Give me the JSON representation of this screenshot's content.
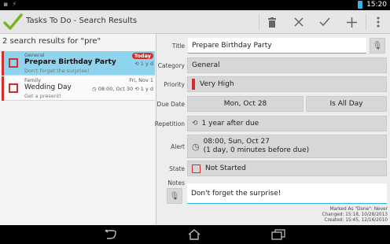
{
  "status": {
    "time": "15:20"
  },
  "actionbar": {
    "title": "Tasks To Do - Search Results"
  },
  "search": {
    "header": "2 search results for \"pre\""
  },
  "tasks": [
    {
      "category": "General",
      "name": "Prepare Birthday Party",
      "note": "Don't forget the surprise!",
      "badge": "Today",
      "repeat": "1 y d"
    },
    {
      "category": "Family",
      "name": "Wedding Day",
      "note": "Get a present!",
      "due": "Fri, Nov 1",
      "alert": "08:00, Oct 30",
      "repeat": "1 y d"
    }
  ],
  "detail": {
    "labels": {
      "title": "Title",
      "category": "Category",
      "priority": "Priority",
      "due_date": "Due Date",
      "repetition": "Repetition",
      "alert": "Alert",
      "state": "State",
      "notes": "Notes"
    },
    "title": "Prepare Birthday Party",
    "category": "General",
    "priority": "Very High",
    "due_date": "Mon, Oct 28",
    "due_time": "Is All Day",
    "repetition": "1 year after due",
    "alert_line1": "08:00, Sun, Oct 27",
    "alert_line2": "(1 day, 0 minutes before due)",
    "state": "Not Started",
    "notes": "Don't forget the surprise!",
    "meta": {
      "marked": "Marked As \"Done\": Never",
      "changed": "Changed: 15:18, 10/28/2013",
      "created": "Created: 15:45, 12/16/2010"
    }
  },
  "colors": {
    "accent": "#33b5e5",
    "priority_red": "#d12e2e",
    "selected": "#8ed4ef",
    "check_green": "#8dc63f"
  },
  "icons": [
    "app-check-icon",
    "delete-icon",
    "close-icon",
    "done-check-icon",
    "add-icon",
    "overflow-icon",
    "mic-icon",
    "repeat-icon",
    "alarm-icon",
    "back-icon",
    "home-icon",
    "recents-icon"
  ]
}
